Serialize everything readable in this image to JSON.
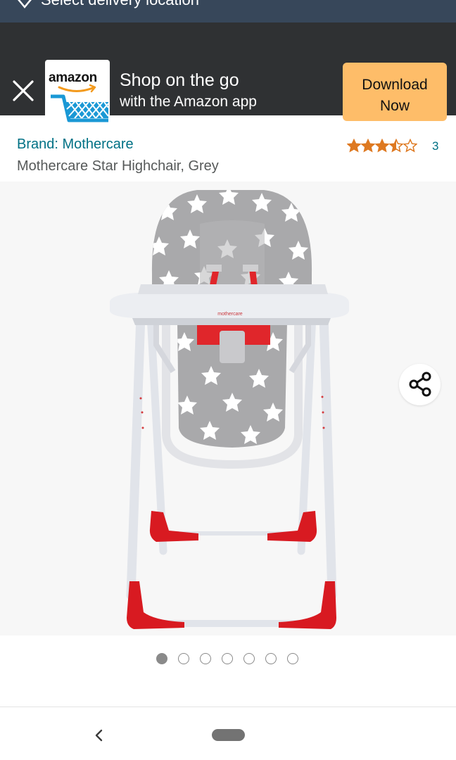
{
  "delivery": {
    "label": "Select delivery location",
    "icon": "location-pin-icon"
  },
  "app_banner": {
    "close_icon": "close-icon",
    "logo_text": "amazon",
    "logo_icon": "amazon-shopping-cart-icon",
    "title_line1": "Shop on the go",
    "title_line2": "with the Amazon app",
    "download_line1": "Download",
    "download_line2": "Now",
    "button_color": "#febd69",
    "background_color": "#2f3133"
  },
  "product": {
    "brand": "Brand: Mothercare",
    "title": "Mothercare Star Highchair, Grey",
    "rating_stars": 3.5,
    "rating_max": 5,
    "rating_count": "3",
    "star_color": "#de7921",
    "link_color": "#007185"
  },
  "gallery": {
    "image_alt": "mothercare",
    "share_icon": "share-icon",
    "image_count": 7,
    "active_index": 0
  },
  "system_nav": {
    "back_icon": "back-chevron-icon",
    "home_icon": "home-pill-icon"
  }
}
